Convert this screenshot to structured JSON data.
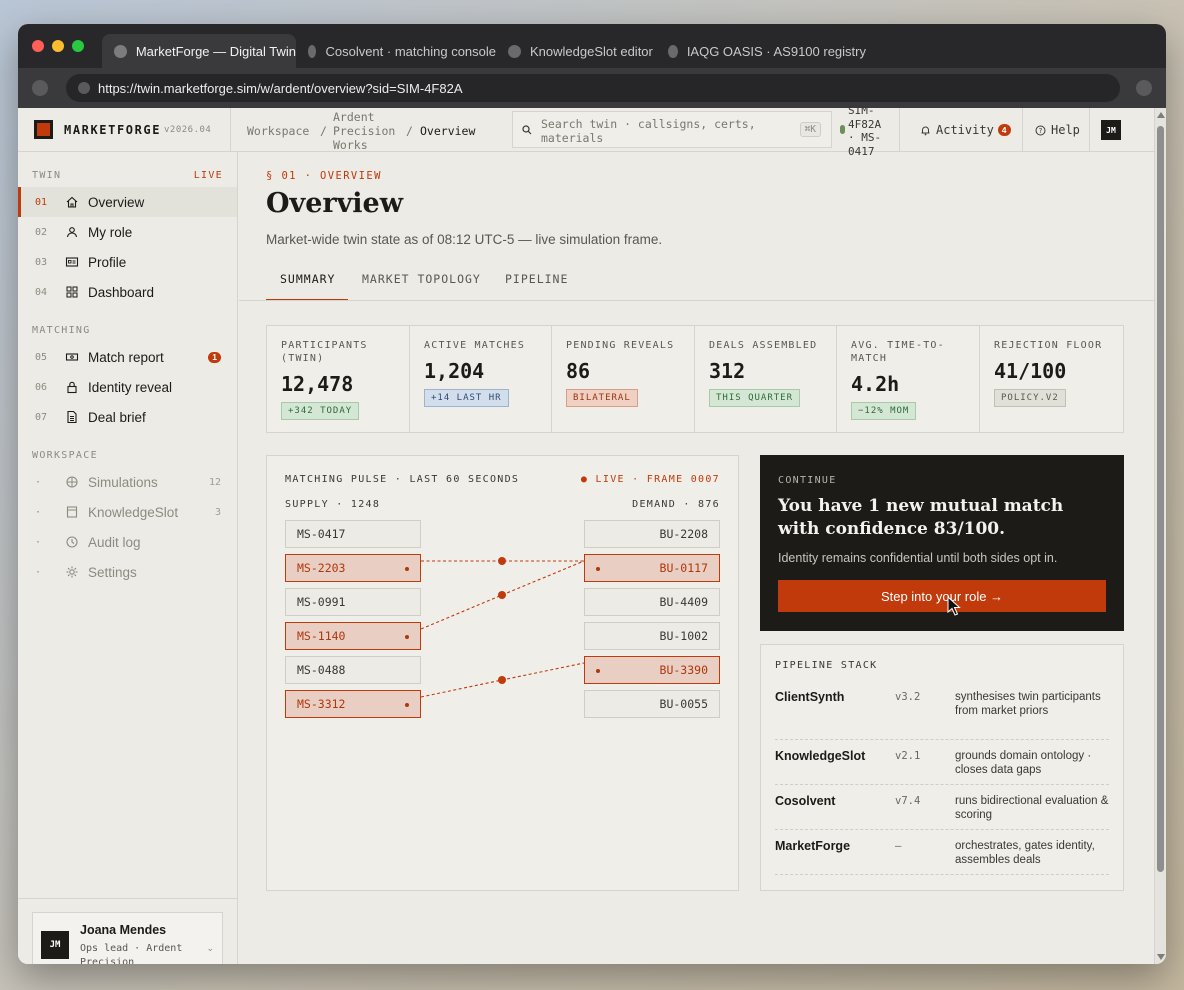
{
  "browser": {
    "tabs": [
      {
        "label": "MarketForge — Digital Twin",
        "active": true
      },
      {
        "label": "Cosolvent · matching console",
        "active": false
      },
      {
        "label": "KnowledgeSlot editor",
        "active": false
      },
      {
        "label": "IAQG OASIS · AS9100 registry",
        "active": false
      }
    ],
    "url": "https://twin.marketforge.sim/w/ardent/overview?sid=SIM-4F82A"
  },
  "topbar": {
    "brand": "MARKETFORGE",
    "version": "v2026.04",
    "breadcrumb": {
      "workspace": "Workspace",
      "sep": "/",
      "org_line1": "Ardent",
      "org_line2": "Precision",
      "org_line3": "Works",
      "current": "Overview"
    },
    "search_placeholder": "Search twin · callsigns, certs, materials",
    "search_shortcut": "⌘K",
    "session_id": "SIM-4F82A · MS-0417",
    "activity_label": "Activity",
    "activity_count": "4",
    "help_label": "Help",
    "avatar_initials": "JM"
  },
  "sidebar": {
    "twin_section": "TWIN",
    "live_tag": "LIVE",
    "twin_items": [
      {
        "num": "01",
        "label": "Overview",
        "icon": "home-icon"
      },
      {
        "num": "02",
        "label": "My role",
        "icon": "user-icon"
      },
      {
        "num": "03",
        "label": "Profile",
        "icon": "id-card-icon"
      },
      {
        "num": "04",
        "label": "Dashboard",
        "icon": "grid-icon"
      }
    ],
    "matching_section": "MATCHING",
    "matching_items": [
      {
        "num": "05",
        "label": "Match report",
        "badge": "1",
        "icon": "ticket-icon"
      },
      {
        "num": "06",
        "label": "Identity reveal",
        "icon": "lock-icon"
      },
      {
        "num": "07",
        "label": "Deal brief",
        "icon": "document-icon"
      }
    ],
    "workspace_section": "WORKSPACE",
    "workspace_items": [
      {
        "num": "·",
        "label": "Simulations",
        "count": "12",
        "icon": "globe-icon"
      },
      {
        "num": "·",
        "label": "KnowledgeSlot",
        "count": "3",
        "icon": "book-icon"
      },
      {
        "num": "·",
        "label": "Audit log",
        "icon": "clock-icon"
      },
      {
        "num": "·",
        "label": "Settings",
        "icon": "gear-icon"
      }
    ],
    "user": {
      "initials": "JM",
      "name": "Joana Mendes",
      "role": "Ops lead · Ardent Precision"
    }
  },
  "main": {
    "kicker": "§ 01 · OVERVIEW",
    "title": "Overview",
    "subtitle": "Market-wide twin state as of 08:12 UTC-5 — live simulation frame.",
    "tabs": [
      "SUMMARY",
      "MARKET TOPOLOGY",
      "PIPELINE"
    ],
    "stats": [
      {
        "label": "PARTICIPANTS (TWIN)",
        "value": "12,478",
        "badge": "+342 TODAY",
        "tone": "green"
      },
      {
        "label": "ACTIVE MATCHES",
        "value": "1,204",
        "badge": "+14 LAST HR",
        "tone": "blue"
      },
      {
        "label": "PENDING REVEALS",
        "value": "86",
        "badge": "BILATERAL",
        "tone": "red"
      },
      {
        "label": "DEALS ASSEMBLED",
        "value": "312",
        "badge": "THIS QUARTER",
        "tone": "green"
      },
      {
        "label": "AVG. TIME-TO-MATCH",
        "value": "4.2h",
        "badge": "−12% MOM",
        "tone": "green"
      },
      {
        "label": "REJECTION FLOOR",
        "value": "41/100",
        "badge": "POLICY.V2",
        "tone": "grey"
      }
    ],
    "pulse": {
      "title": "MATCHING PULSE · LAST 60 SECONDS",
      "live": "● LIVE · FRAME 0007",
      "supply_label": "SUPPLY · 1248",
      "demand_label": "DEMAND · 876",
      "supply": [
        {
          "id": "MS-0417",
          "matched": false
        },
        {
          "id": "MS-2203",
          "matched": true
        },
        {
          "id": "MS-0991",
          "matched": false
        },
        {
          "id": "MS-1140",
          "matched": true
        },
        {
          "id": "MS-0488",
          "matched": false
        },
        {
          "id": "MS-3312",
          "matched": true
        }
      ],
      "demand": [
        {
          "id": "BU-2208",
          "matched": false
        },
        {
          "id": "BU-0117",
          "matched": true
        },
        {
          "id": "BU-4409",
          "matched": false
        },
        {
          "id": "BU-1002",
          "matched": false
        },
        {
          "id": "BU-3390",
          "matched": true
        },
        {
          "id": "BU-0055",
          "matched": false
        }
      ]
    },
    "cta": {
      "kicker": "CONTINUE",
      "headline": "You have 1 new mutual match with confidence 83/100.",
      "note": "Identity remains confidential until both sides opt in.",
      "button": "Step into your role →"
    },
    "stack": {
      "title": "PIPELINE STACK",
      "rows": [
        {
          "name": "ClientSynth",
          "version": "v3.2",
          "desc": "synthesises twin participants from market priors"
        },
        {
          "name": "KnowledgeSlot",
          "version": "v2.1",
          "desc": "grounds domain ontology · closes data gaps"
        },
        {
          "name": "Cosolvent",
          "version": "v7.4",
          "desc": "runs bidirectional evaluation & scoring"
        },
        {
          "name": "MarketForge",
          "version": "—",
          "desc": "orchestrates, gates identity, assembles deals"
        }
      ]
    }
  },
  "colors": {
    "accent": "#c03a0c",
    "ink": "#1c1b18",
    "paper": "#ecebe5"
  }
}
